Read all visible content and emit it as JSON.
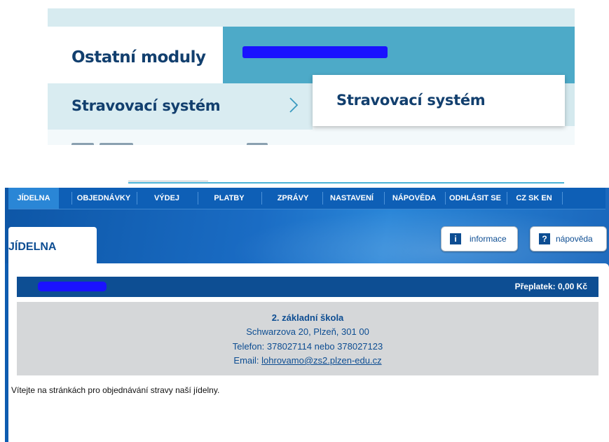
{
  "top_menu": {
    "tab_active": "Ostatní moduly",
    "tab_redacted": "",
    "submenu_item": "Stravovací systém",
    "flyout_item": "Stravovací systém"
  },
  "nav": {
    "items": [
      "JÍDELNA",
      "OBJEDNÁVKY",
      "VÝDEJ",
      "PLATBY",
      "ZPRÁVY",
      "NASTAVENÍ",
      "NÁPOVĚDA",
      "ODHLÁSIT SE",
      "CZ SK EN"
    ]
  },
  "page": {
    "title": "JÍDELNA",
    "info_button": "informace",
    "help_button": "nápověda",
    "info_icon": "i",
    "help_icon": "?"
  },
  "account": {
    "overpayment": "Přeplatek: 0,00 Kč"
  },
  "school": {
    "name": "2. základní škola",
    "address": "Schwarzova 20, Plzeň, 301 00",
    "phone": "Telefon: 378027114 nebo 378027123",
    "email_label": "Email: ",
    "email": "lohrovamo@zs2.plzen-edu.cz"
  },
  "welcome": "Vítejte na stránkách pro objednávání stravy naší jídelny.",
  "colors": {
    "brand_dark": "#0d4e93",
    "nav_blue": "#0e5fb6",
    "redaction": "#1a12ff",
    "teal_tab": "#4daac8"
  }
}
